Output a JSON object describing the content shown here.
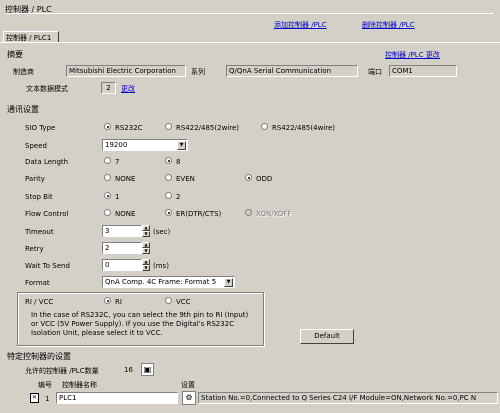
{
  "window_title": "控制器 / PLC",
  "links": {
    "add": "添加控制器 /PLC",
    "delete": "删除控制器 /PLC",
    "change_controller": "控制器 /PLC 更改",
    "change_text_mode": "更改"
  },
  "tab": "控制器 / PLC1",
  "summary": {
    "title": "摘要",
    "manufacturer_label": "制造商",
    "manufacturer": "Mitsubishi Electric Corporation",
    "series_label": "系列",
    "series": "Q/QnA Serial Communication",
    "port_label": "端口",
    "port": "COM1",
    "text_mode_label": "文本数据模式",
    "text_mode": "2"
  },
  "comm": {
    "title": "通讯设置",
    "sio_label": "SIO Type",
    "sio_opts": [
      "RS232C",
      "RS422/485(2wire)",
      "RS422/485(4wire)"
    ],
    "speed_label": "Speed",
    "speed": "19200",
    "datalen_label": "Data Length",
    "datalen_opts": [
      "7",
      "8"
    ],
    "parity_label": "Parity",
    "parity_opts": [
      "NONE",
      "EVEN",
      "ODD"
    ],
    "stopbit_label": "Stop Bit",
    "stopbit_opts": [
      "1",
      "2"
    ],
    "flow_label": "Flow Control",
    "flow_opts": [
      "NONE",
      "ER(DTR/CTS)",
      "XON/XOFF"
    ],
    "timeout_label": "Timeout",
    "timeout": "3",
    "timeout_unit": "(sec)",
    "retry_label": "Retry",
    "retry": "2",
    "wait_label": "Wait To Send",
    "wait": "0",
    "wait_unit": "(ms)",
    "format_label": "Format",
    "format": "QnA Comp. 4C Frame: Format 5",
    "rivcc_label": "RI / VCC",
    "rivcc_opts": [
      "RI",
      "VCC"
    ],
    "rivcc_note": "In the case of RS232C, you can select the 9th pin to RI (Input)\nor VCC (5V Power Supply). If you use the Digital's RS232C\nIsolation Unit, please select it to VCC.",
    "default_btn": "Default"
  },
  "specific": {
    "title": "特定控制器的设置",
    "allowed_label": "允许的控制器 /PLC数量",
    "allowed_count": "16",
    "col_no": "编号",
    "col_name": "控制器名称",
    "col_settings": "设置",
    "row_no": "1",
    "row_name": "PLC1",
    "row_settings": "Station No.=0,Connected to Q Series C24 I/F Module=ON,Network No.=0,PC N"
  }
}
